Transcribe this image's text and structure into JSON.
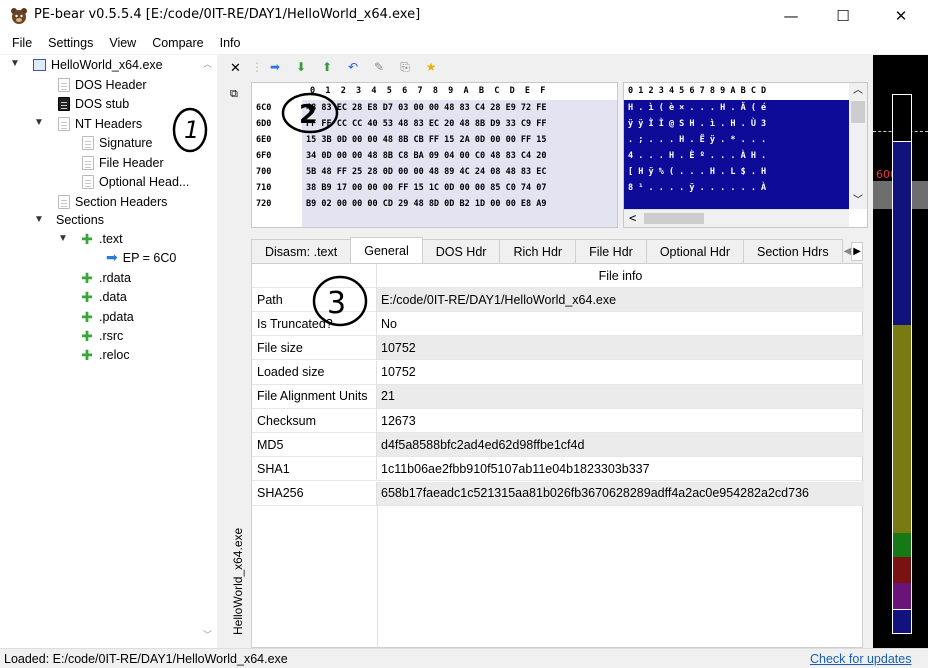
{
  "window": {
    "title": "PE-bear v0.5.5.4 [E:/code/0IT-RE/DAY1/HelloWorld_x64.exe]",
    "minimize": "—",
    "maximize": "☐",
    "close": "✕"
  },
  "menu": [
    "File",
    "Settings",
    "View",
    "Compare",
    "Info"
  ],
  "tree": {
    "root": "HelloWorld_x64.exe",
    "dos_header": "DOS Header",
    "dos_stub": "DOS stub",
    "nt_headers": "NT Headers",
    "signature": "Signature",
    "file_header": "File Header",
    "optional_header": "Optional Head...",
    "section_headers": "Section Headers",
    "sections": "Sections",
    "text": ".text",
    "ep": "EP = 6C0",
    "rdata": ".rdata",
    "data": ".data",
    "pdata": ".pdata",
    "rsrc": ".rsrc",
    "reloc": ".reloc"
  },
  "side_label": "HelloWorld_x64.exe",
  "hex": {
    "header": "0  1  2  3  4  5  6  7  8  9  A  B  C  D  E  F",
    "rows": [
      {
        "addr": "6C0",
        "bytes": "48 83 EC 28 E8 D7 03 00 00 48 83 C4 28 E9 72 FE"
      },
      {
        "addr": "6D0",
        "bytes": "FF FF CC CC 40 53 48 83 EC 20 48 8B D9 33 C9 FF"
      },
      {
        "addr": "6E0",
        "bytes": "15 3B 0D 00 00 48 8B CB FF 15 2A 0D 00 00 FF 15"
      },
      {
        "addr": "6F0",
        "bytes": "34 0D 00 00 48 8B C8 BA 09 04 00 C0 48 83 C4 20"
      },
      {
        "addr": "700",
        "bytes": "5B 48 FF 25 28 0D 00 00 48 89 4C 24 08 48 83 EC"
      },
      {
        "addr": "710",
        "bytes": "38 B9 17 00 00 00 FF 15 1C 0D 00 00 85 C0 74 07"
      },
      {
        "addr": "720",
        "bytes": "B9 02 00 00 00 CD 29 48 8D 0D B2 1D 00 00 E8 A9"
      }
    ]
  },
  "ascii": {
    "header": "0 1 2 3 4 5 6 7 8 9 A B C D",
    "rows": [
      "H . ì ( è × . . . H . Ä ( é",
      "ÿ ÿ Ì Ì @ S H . ì . H . Ù 3",
      ". ; . . . H . Ë ÿ . * . . .",
      "4 . . . H . È º . . . À H .",
      "[ H ÿ % ( . . . H . L $ . H",
      "8 ¹ . . . . ÿ . . . . . . À",
      ""
    ],
    "scroll_left": "<"
  },
  "tabs": [
    "Disasm: .text",
    "General",
    "DOS Hdr",
    "Rich Hdr",
    "File Hdr",
    "Optional Hdr",
    "Section Hdrs"
  ],
  "file_info": {
    "header": "File info",
    "rows": [
      {
        "key": "Path",
        "value": "E:/code/0IT-RE/DAY1/HelloWorld_x64.exe"
      },
      {
        "key": "Is Truncated?",
        "value": "No"
      },
      {
        "key": "File size",
        "value": "10752"
      },
      {
        "key": "Loaded size",
        "value": "10752"
      },
      {
        "key": "File Alignment Units",
        "value": "21"
      },
      {
        "key": "Checksum",
        "value": "12673"
      },
      {
        "key": "MD5",
        "value": "d4f5a8588bfc2ad4ed62d98ffbe1cf4d"
      },
      {
        "key": "SHA1",
        "value": "1c11b06ae2fbb910f5107ab11e04b1823303b337"
      },
      {
        "key": "SHA256",
        "value": "658b17faeadc1c521315aa81b026fb3670628289adff4a2ac0e954282a2cd736"
      }
    ]
  },
  "map": {
    "label": "600"
  },
  "status": {
    "text": "Loaded: E:/code/0IT-RE/DAY1/HelloWorld_x64.exe",
    "link": "Check for updates"
  },
  "annotations": [
    "1",
    "2",
    "3"
  ]
}
